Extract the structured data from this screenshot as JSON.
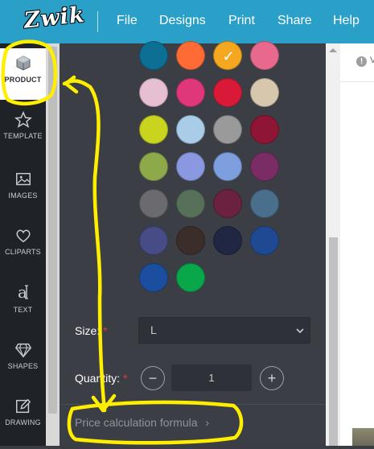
{
  "header": {
    "logo_text": "Zwik",
    "menu": [
      "File",
      "Designs",
      "Print",
      "Share",
      "Help"
    ]
  },
  "sidebar": {
    "items": [
      {
        "label": "PRODUCT",
        "icon": "cube-icon",
        "active": true
      },
      {
        "label": "TEMPLATE",
        "icon": "star-icon"
      },
      {
        "label": "IMAGES",
        "icon": "image-icon"
      },
      {
        "label": "CLIPARTS",
        "icon": "heart-icon"
      },
      {
        "label": "TEXT",
        "icon": "text-icon"
      },
      {
        "label": "SHAPES",
        "icon": "diamond-icon"
      },
      {
        "label": "DRAWING",
        "icon": "pencil-icon"
      }
    ]
  },
  "colors": {
    "swatches": [
      [
        "#0d6f94",
        "#ff6b35",
        "#f4a71f",
        "#e8698d"
      ],
      [
        "#e6bfd3",
        "#e0367a",
        "#d81a38",
        "#d7c7ad"
      ],
      [
        "#c8d41d",
        "#a9cde8",
        "#9a9a9a",
        "#8e1533"
      ],
      [
        "#8ea94a",
        "#8a98e0",
        "#7e9fdd",
        "#7a2d64"
      ],
      [
        "#6b6b6f",
        "#56705a",
        "#6b2140",
        "#4a6f8d"
      ],
      [
        "#474c86",
        "#3a2d2a",
        "#202743",
        "#1f4a93"
      ],
      [
        "#1b4e9e",
        "#0aa64a"
      ]
    ],
    "selected": "#f4a71f"
  },
  "form": {
    "size_label": "Size:",
    "size_required": "*",
    "size_value": "L",
    "quantity_label": "Quantity:",
    "quantity_required": "*",
    "quantity_value": "1",
    "minus": "−",
    "plus": "+",
    "price_link": "Price calculation formula",
    "price_chevron": "›"
  },
  "right": {
    "info_icon": "info-icon",
    "fragment": "V"
  },
  "accent": {
    "header_bg": "#2aa0c8",
    "annotation": "#ffee00"
  }
}
